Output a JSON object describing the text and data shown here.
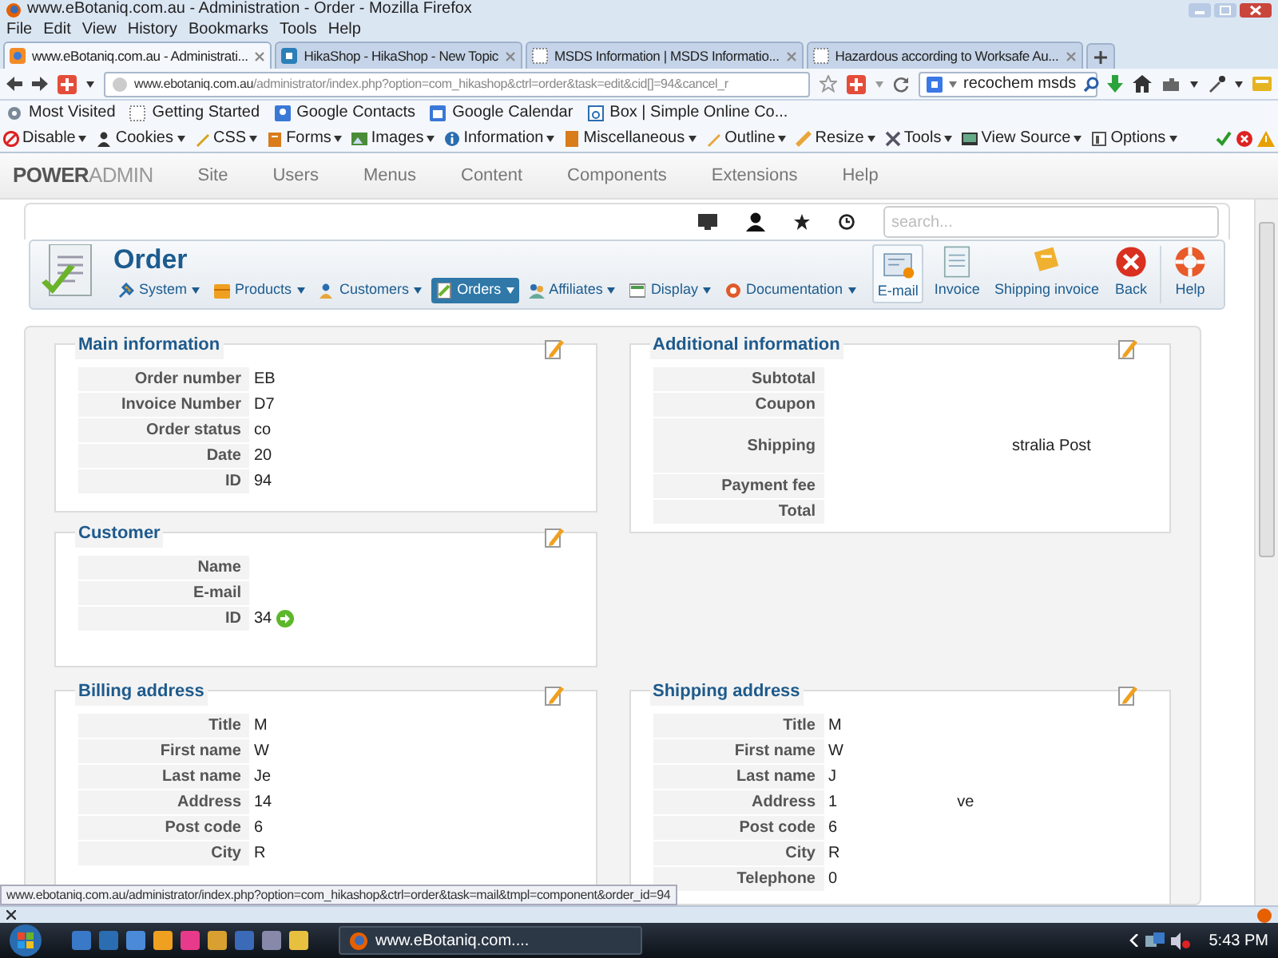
{
  "window": {
    "title": "www.eBotaniq.com.au - Administration - Order - Mozilla Firefox"
  },
  "menu": [
    "File",
    "Edit",
    "View",
    "History",
    "Bookmarks",
    "Tools",
    "Help"
  ],
  "tabs": [
    {
      "label": "www.eBotaniq.com.au - Administrati...",
      "selected": true
    },
    {
      "label": "HikaShop - HikaShop - New Topic",
      "selected": false
    },
    {
      "label": "MSDS Information | MSDS Informatio...",
      "selected": false
    },
    {
      "label": "Hazardous according to Worksafe Au...",
      "selected": false
    }
  ],
  "address_bar": {
    "domain": "www.ebotaniq.com.au",
    "path": "/administrator/index.php?option=com_hikashop&ctrl=order&task=edit&cid[]=94&cancel_r"
  },
  "search_bar": {
    "value": "recochem msds"
  },
  "bookmarks": [
    "Most Visited",
    "Getting Started",
    "Google Contacts",
    "Google Calendar",
    "Box | Simple Online Co..."
  ],
  "developer_toolbar": [
    "Disable",
    "Cookies",
    "CSS",
    "Forms",
    "Images",
    "Information",
    "Miscellaneous",
    "Outline",
    "Resize",
    "Tools",
    "View Source",
    "Options"
  ],
  "admin_menu": {
    "brand": "**POWER**ADMIN",
    "items": [
      "Site",
      "Users",
      "Menus",
      "Content",
      "Components",
      "Extensions",
      "Help"
    ]
  },
  "admin_search": {
    "placeholder": "search..."
  },
  "page": {
    "title": "Order",
    "submenu": [
      {
        "label": "System",
        "selected": false
      },
      {
        "label": "Products",
        "selected": false
      },
      {
        "label": "Customers",
        "selected": false
      },
      {
        "label": "Orders",
        "selected": true
      },
      {
        "label": "Affiliates",
        "selected": false
      },
      {
        "label": "Display",
        "selected": false
      },
      {
        "label": "Documentation",
        "selected": false
      }
    ],
    "toolbar": [
      "E-mail",
      "Invoice",
      "Shipping invoice",
      "Back",
      "Help"
    ]
  },
  "panels": {
    "main_information": {
      "title": "Main information",
      "rows": [
        {
          "label": "Order number",
          "value": "EB"
        },
        {
          "label": "Invoice Number",
          "value": "D7"
        },
        {
          "label": "Order status",
          "value": "co"
        },
        {
          "label": "Date",
          "value": "20"
        },
        {
          "label": "ID",
          "value": "94"
        }
      ]
    },
    "customer": {
      "title": "Customer",
      "rows": [
        {
          "label": "Name"
        },
        {
          "label": "E-mail"
        },
        {
          "label": "ID",
          "value": "34"
        }
      ]
    },
    "additional_information": {
      "title": "Additional information",
      "rows": [
        {
          "label": "Subtotal"
        },
        {
          "label": "Coupon"
        },
        {
          "label": "Shipping",
          "value_2": "stralia Post"
        },
        {
          "label": "Payment fee"
        },
        {
          "label": "Total"
        }
      ]
    },
    "billing_address": {
      "title": "Billing address",
      "rows": [
        {
          "label": "Title",
          "value": "M"
        },
        {
          "label": "First name",
          "value": "W"
        },
        {
          "label": "Last name",
          "value": "Je"
        },
        {
          "label": "Address",
          "value": "14"
        },
        {
          "label": "Post code",
          "value": "6"
        },
        {
          "label": "City",
          "value": "R"
        }
      ]
    },
    "shipping_address": {
      "title": "Shipping address",
      "rows": [
        {
          "label": "Title",
          "value": "M"
        },
        {
          "label": "First name",
          "value": "W"
        },
        {
          "label": "Last name",
          "value": "J"
        },
        {
          "label": "Address",
          "value": "1",
          "value_2": "ve"
        },
        {
          "label": "Post code",
          "value": "6"
        },
        {
          "label": "City",
          "value": "R"
        },
        {
          "label": "Telephone",
          "value": "0"
        }
      ]
    }
  },
  "status_bar": {
    "url": "www.ebotaniq.com.au/administrator/index.php?option=com_hikashop&ctrl=order&task=mail&tmpl=component&order_id=94"
  },
  "taskbar": {
    "task": "www.eBotaniq.com....",
    "time": "5:43 PM"
  }
}
